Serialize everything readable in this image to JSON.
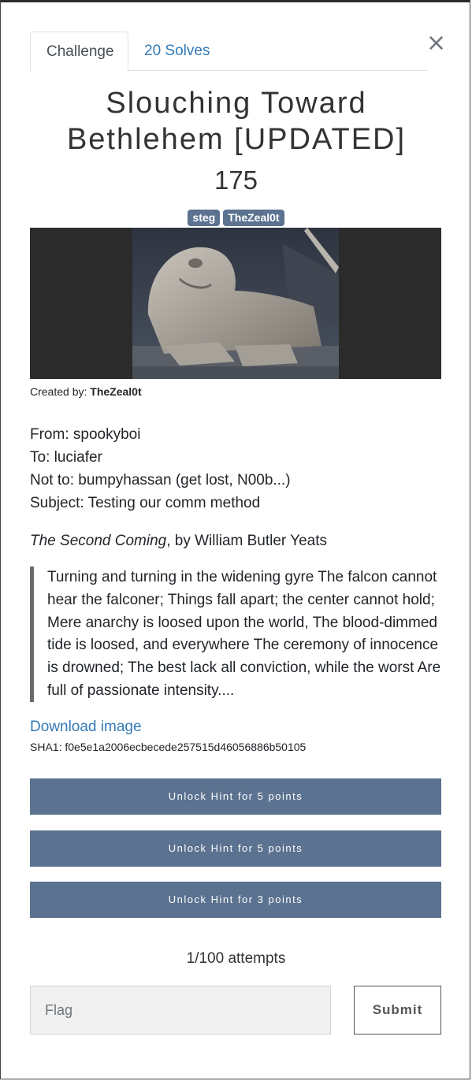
{
  "modal": {
    "close_label": "×"
  },
  "tabs": [
    {
      "label": "Challenge",
      "active": true
    },
    {
      "label": "20 Solves",
      "active": false
    }
  ],
  "challenge": {
    "title_line1": "Slouching Toward",
    "title_line2": "Bethlehem [UPDATED]",
    "points": "175",
    "tags": [
      "steg",
      "TheZeal0t"
    ],
    "created_by_label": "Created by:",
    "created_by": "TheZeal0t"
  },
  "description": {
    "lines": [
      "From: spookyboi",
      "To: luciafer",
      "Not to: bumpyhassan (get lost, N00b...)",
      "Subject: Testing our comm method"
    ],
    "poem_title_italic": "The Second Coming",
    "poem_title_rest": ", by William Butler Yeats",
    "quote": "Turning and turning in the widening gyre The falcon cannot hear the falconer; Things fall apart; the center cannot hold; Mere anarchy is loosed upon the world, The blood-dimmed tide is loosed, and everywhere The ceremony of innocence is drowned; The best lack all conviction, while the worst Are full of passionate intensity...."
  },
  "download": {
    "label": "Download image",
    "sha": "SHA1: f0e5e1a2006ecbecede257515d46056886b50105"
  },
  "hints": [
    {
      "label": "Unlock Hint for 5 points"
    },
    {
      "label": "Unlock Hint for 5 points"
    },
    {
      "label": "Unlock Hint for 3 points"
    }
  ],
  "attempts": "1/100 attempts",
  "flag": {
    "placeholder": "Flag",
    "value": ""
  },
  "submit_label": "Submit",
  "colors": {
    "accent": "#5b7290",
    "link": "#337ab7"
  }
}
